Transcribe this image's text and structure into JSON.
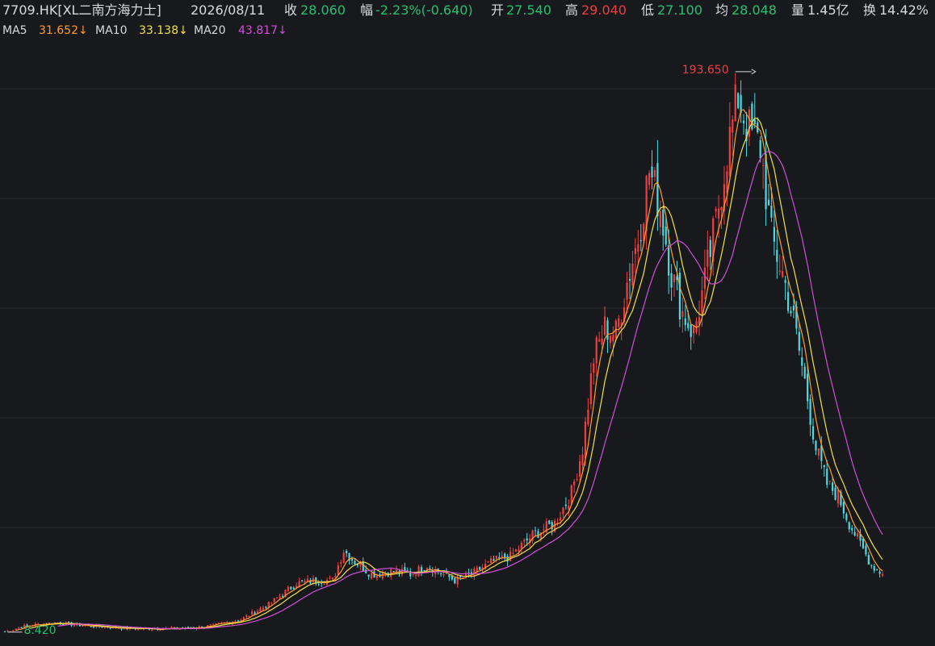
{
  "header": {
    "ticker": "7709.HK[XL二南方海力士]",
    "date": "2026/08/11",
    "close_label": "收",
    "close_value": "28.060",
    "change_label": "幅",
    "change_value": "-2.23%(-0.640)",
    "open_label": "开",
    "open_value": "27.540",
    "high_label": "高",
    "high_value": "29.040",
    "low_label": "低",
    "low_value": "27.100",
    "avg_label": "均",
    "avg_value": "28.048",
    "volume_label": "量",
    "volume_value": "1.45亿",
    "turnover_label": "换",
    "turnover_value": "14.42%"
  },
  "ma_legend": {
    "ma5_label": "MA5",
    "ma5_value": "31.652↓",
    "ma10_label": "MA10",
    "ma10_value": "33.138↓",
    "ma20_label": "MA20",
    "ma20_value": "43.817↓"
  },
  "colors": {
    "background": "#17191d",
    "grid": "#2a2e35",
    "up": "#f03e3e",
    "down": "#4fd8e0",
    "ma5": "#ff9c2a",
    "ma10": "#f4e04d",
    "ma20": "#d24fd8"
  },
  "chart_data": {
    "type": "candlestick",
    "title": "",
    "ylim": [
      5,
      200
    ],
    "grid": true,
    "annotations": {
      "max_label": "193.650",
      "min_label": "8.420"
    },
    "close_anchors": [
      [
        0,
        9
      ],
      [
        8,
        11
      ],
      [
        18,
        12
      ],
      [
        28,
        11
      ],
      [
        45,
        10
      ],
      [
        55,
        10
      ],
      [
        65,
        10
      ],
      [
        75,
        11
      ],
      [
        85,
        13
      ],
      [
        95,
        18
      ],
      [
        105,
        25
      ],
      [
        112,
        26
      ],
      [
        118,
        26
      ],
      [
        122,
        36
      ],
      [
        125,
        33
      ],
      [
        132,
        28
      ],
      [
        140,
        29
      ],
      [
        146,
        28
      ],
      [
        152,
        31
      ],
      [
        158,
        28
      ],
      [
        162,
        26
      ],
      [
        168,
        28
      ],
      [
        175,
        32
      ],
      [
        182,
        34
      ],
      [
        190,
        41
      ],
      [
        198,
        45
      ],
      [
        204,
        55
      ],
      [
        208,
        70
      ],
      [
        212,
        100
      ],
      [
        216,
        110
      ],
      [
        220,
        108
      ],
      [
        224,
        125
      ],
      [
        228,
        140
      ],
      [
        232,
        162
      ],
      [
        236,
        150
      ],
      [
        240,
        128
      ],
      [
        244,
        115
      ],
      [
        248,
        108
      ],
      [
        252,
        125
      ],
      [
        256,
        145
      ],
      [
        260,
        168
      ],
      [
        264,
        187
      ],
      [
        268,
        175
      ],
      [
        272,
        170
      ],
      [
        276,
        140
      ],
      [
        280,
        128
      ],
      [
        284,
        112
      ],
      [
        288,
        92
      ],
      [
        292,
        70
      ],
      [
        296,
        58
      ],
      [
        300,
        54
      ],
      [
        304,
        45
      ],
      [
        308,
        38
      ],
      [
        312,
        31
      ],
      [
        316,
        28
      ]
    ],
    "n": 317,
    "last": {
      "open": 27.54,
      "high": 29.04,
      "low": 27.1,
      "close": 28.06
    }
  }
}
